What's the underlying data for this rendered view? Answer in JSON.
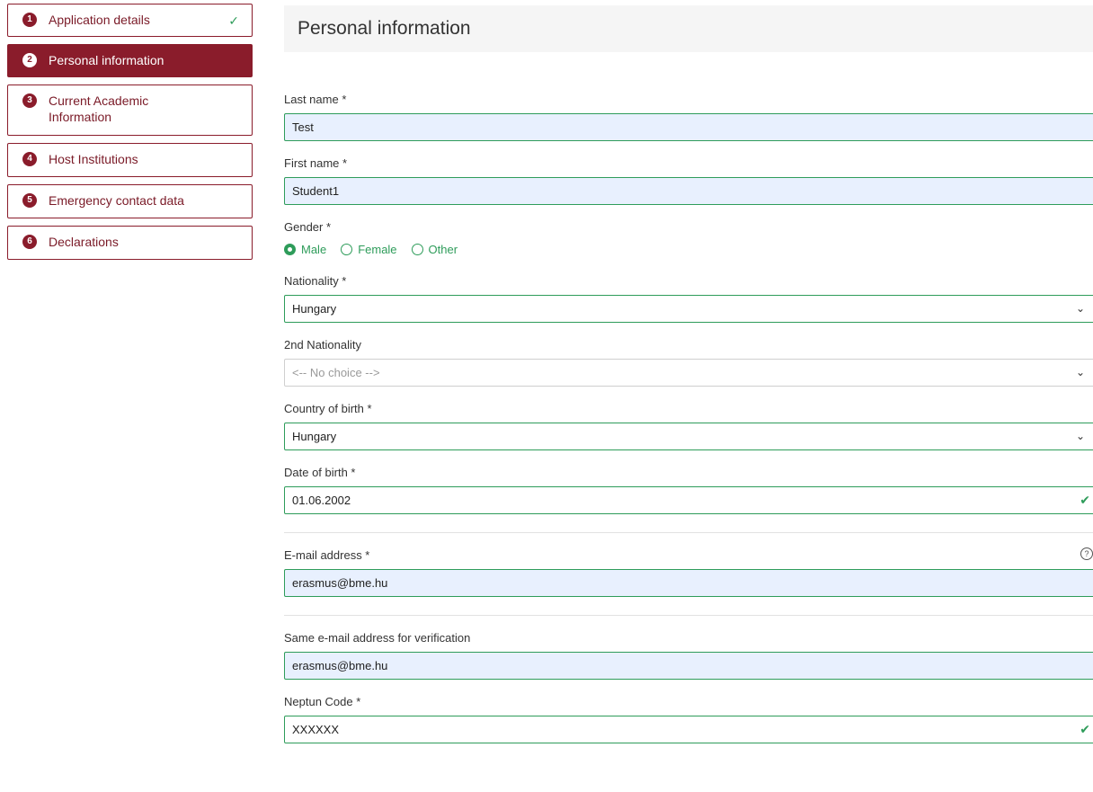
{
  "sidebar": {
    "items": [
      {
        "number": "1",
        "label": "Application details",
        "check": "✓"
      },
      {
        "number": "2",
        "label": "Personal information"
      },
      {
        "number": "3",
        "label": "Current Academic Information"
      },
      {
        "number": "4",
        "label": "Host Institutions"
      },
      {
        "number": "5",
        "label": "Emergency contact data"
      },
      {
        "number": "6",
        "label": "Declarations"
      }
    ]
  },
  "header": {
    "title": "Personal information"
  },
  "form": {
    "last_name": {
      "label": "Last name *",
      "value": "Test"
    },
    "first_name": {
      "label": "First name *",
      "value": "Student1"
    },
    "gender": {
      "label": "Gender *",
      "options": [
        "Male",
        "Female",
        "Other"
      ],
      "selected": "Male"
    },
    "nationality": {
      "label": "Nationality *",
      "value": "Hungary"
    },
    "nationality2": {
      "label": "2nd Nationality",
      "value": "<-- No choice -->"
    },
    "country_of_birth": {
      "label": "Country of birth *",
      "value": "Hungary"
    },
    "date_of_birth": {
      "label": "Date of birth *",
      "value": "01.06.2002"
    },
    "email": {
      "label": "E-mail address *",
      "value": "erasmus@bme.hu",
      "help": "?"
    },
    "email_verify": {
      "label": "Same e-mail address for verification",
      "value": "erasmus@bme.hu"
    },
    "neptun": {
      "label": "Neptun Code *",
      "value": "XXXXXX"
    }
  },
  "icons": {
    "check": "check-icon",
    "chevron": "chevron-down-icon",
    "help": "question-circle-icon"
  },
  "colors": {
    "brand": "#8a1c2b",
    "success": "#2e9c5a",
    "autofill": "#e8f0fe"
  }
}
